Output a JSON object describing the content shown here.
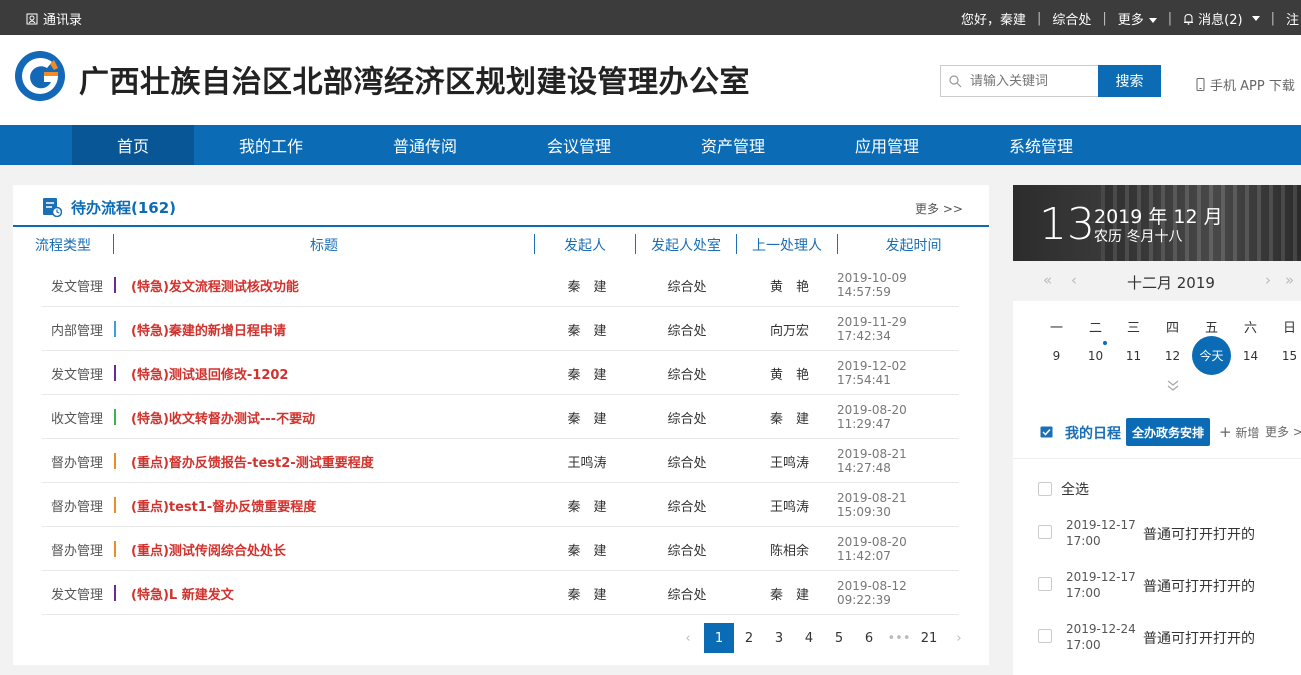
{
  "topbar": {
    "contacts": "通讯录",
    "greeting": "您好，秦建",
    "dept": "综合处",
    "more": "更多",
    "messages": "消息(2)",
    "extra": "注"
  },
  "header": {
    "title": "广西壮族自治区北部湾经济区规划建设管理办公室",
    "search_placeholder": "请输入关键词",
    "search_button": "搜索",
    "app_download": "手机 APP 下载"
  },
  "nav": [
    "首页",
    "我的工作",
    "普通传阅",
    "会议管理",
    "资产管理",
    "应用管理",
    "系统管理"
  ],
  "pending": {
    "title": "待办流程(162)",
    "more": "更多 >>",
    "columns": [
      "流程类型",
      "标题",
      "发起人",
      "发起人处室",
      "上一处理人",
      "发起时间"
    ],
    "rows": [
      {
        "type": "发文管理",
        "bar": "#6a2a9e",
        "title": "(特急)发文流程测试核改功能",
        "person": "秦　建",
        "dept": "综合处",
        "prev": "黄　艳",
        "time": "2019-10-09 14:57:59"
      },
      {
        "type": "内部管理",
        "bar": "#3aa0e0",
        "title": "(特急)秦建的新增日程申请",
        "person": "秦　建",
        "dept": "综合处",
        "prev": "向万宏",
        "time": "2019-11-29 17:42:34"
      },
      {
        "type": "发文管理",
        "bar": "#6a2a9e",
        "title": "(特急)测试退回修改-1202",
        "person": "秦　建",
        "dept": "综合处",
        "prev": "黄　艳",
        "time": "2019-12-02 17:54:41"
      },
      {
        "type": "收文管理",
        "bar": "#3cb44b",
        "title": "(特急)收文转督办测试---不要动",
        "person": "秦　建",
        "dept": "综合处",
        "prev": "秦　建",
        "time": "2019-08-20 11:29:47"
      },
      {
        "type": "督办管理",
        "bar": "#f08c28",
        "title": "(重点)督办反馈报告-test2-测试重要程度",
        "person": "王鸣涛",
        "dept": "综合处",
        "prev": "王鸣涛",
        "time": "2019-08-21 14:27:48"
      },
      {
        "type": "督办管理",
        "bar": "#f08c28",
        "title": "(重点)test1-督办反馈重要程度",
        "person": "秦　建",
        "dept": "综合处",
        "prev": "王鸣涛",
        "time": "2019-08-21 15:09:30"
      },
      {
        "type": "督办管理",
        "bar": "#f08c28",
        "title": "(重点)测试传阅综合处处长",
        "person": "秦　建",
        "dept": "综合处",
        "prev": "陈相余",
        "time": "2019-08-20 11:42:07"
      },
      {
        "type": "发文管理",
        "bar": "#6a2a9e",
        "title": "(特急)L 新建发文",
        "person": "秦　建",
        "dept": "综合处",
        "prev": "秦　建",
        "time": "2019-08-12 09:22:39"
      }
    ],
    "pages": [
      "1",
      "2",
      "3",
      "4",
      "5",
      "6",
      "•••",
      "21"
    ],
    "current_page": "1"
  },
  "calendar": {
    "day": "13",
    "year_month": "2019 年 12 月",
    "lunar": "农历 冬月十八",
    "month_label": "十二月  2019",
    "weekdays": [
      "一",
      "二",
      "三",
      "四",
      "五",
      "六",
      "日"
    ],
    "dates": [
      "9",
      "10",
      "11",
      "12",
      "今天",
      "14",
      "15"
    ]
  },
  "schedule": {
    "title": "我的日程",
    "all_button": "全办政务安排",
    "add": "新增",
    "more": "更多 >",
    "select_all": "全选",
    "items": [
      {
        "date": "2019-12-17",
        "time": "17:00",
        "text": "普通可打开打开的"
      },
      {
        "date": "2019-12-17",
        "time": "17:00",
        "text": "普通可打开打开的"
      },
      {
        "date": "2019-12-24",
        "time": "17:00",
        "text": "普通可打开打开的"
      }
    ]
  },
  "colors": {
    "brand": "#0b6cb5",
    "urgent_text": "#d2322d",
    "topbar": "#3c3c3c"
  }
}
